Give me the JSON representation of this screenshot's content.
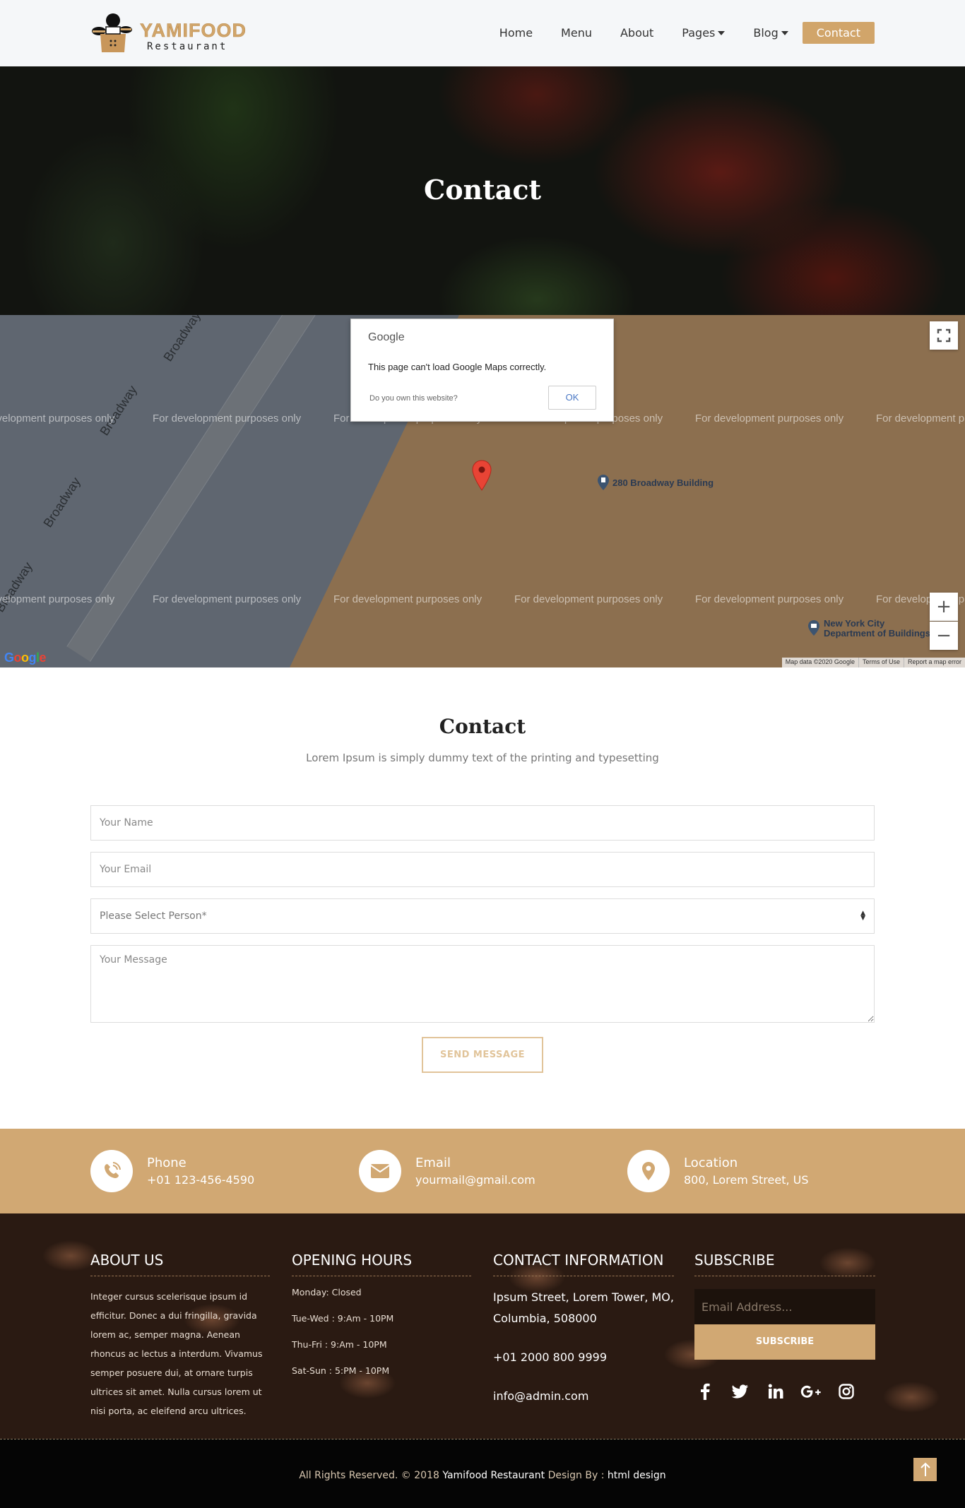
{
  "brand": {
    "name": "YAMIFOOD",
    "tagline": "Restaurant"
  },
  "nav": {
    "items": [
      {
        "label": "Home"
      },
      {
        "label": "Menu"
      },
      {
        "label": "About"
      },
      {
        "label": "Pages"
      },
      {
        "label": "Blog"
      }
    ],
    "cta_label": "Contact"
  },
  "hero": {
    "title": "Contact"
  },
  "map": {
    "dialog_brand": "Google",
    "dialog_message": "This page can't load Google Maps correctly.",
    "dialog_own": "Do you own this website?",
    "dialog_ok": "OK",
    "watermark": "For development purposes only",
    "road_label": "Broadway",
    "poi_1": "280 Broadway Building",
    "poi_2_line1": "New York City",
    "poi_2_line2": "Department of Buildings",
    "logo": "Google",
    "footer_data": "Map data ©2020 Google",
    "footer_terms": "Terms of Use",
    "footer_report": "Report a map error",
    "zoom_in": "+",
    "zoom_out": "−"
  },
  "contact": {
    "title": "Contact",
    "subtitle": "Lorem Ipsum is simply dummy text of the printing and typesetting",
    "name_placeholder": "Your Name",
    "email_placeholder": "Your Email",
    "person_select": "Please Select Person*",
    "message_placeholder": "Your Message",
    "send_label": "SEND MESSAGE"
  },
  "info": {
    "phone_label": "Phone",
    "phone_value": "+01 123-456-4590",
    "email_label": "Email",
    "email_value": "yourmail@gmail.com",
    "location_label": "Location",
    "location_value": "800, Lorem Street, US"
  },
  "footer": {
    "about_title": "ABOUT US",
    "about_text": "Integer cursus scelerisque ipsum id efficitur. Donec a dui fringilla, gravida lorem ac, semper magna. Aenean rhoncus ac lectus a interdum. Vivamus semper posuere dui, at ornare turpis ultrices sit amet. Nulla cursus lorem ut nisi porta, ac eleifend arcu ultrices.",
    "hours_title": "OPENING HOURS",
    "hours": [
      "Monday: Closed",
      "Tue-Wed : 9:Am - 10PM",
      "Thu-Fri : 9:Am - 10PM",
      "Sat-Sun : 5:PM - 10PM"
    ],
    "contact_title": "CONTACT INFORMATION",
    "contact_address": "Ipsum Street, Lorem Tower, MO, Columbia, 508000",
    "contact_phone": "+01 2000 800 9999",
    "contact_email": "info@admin.com",
    "subscribe_title": "SUBSCRIBE",
    "subscribe_placeholder": "Email Address...",
    "subscribe_button": "SUBSCRIBE",
    "social_icons": [
      "facebook-icon",
      "twitter-icon",
      "linkedin-icon",
      "google-plus-icon",
      "instagram-icon"
    ]
  },
  "bottom": {
    "prefix": "All Rights Reserved. © 2018",
    "brand": "Yamifood Restaurant",
    "design_by": "Design By :",
    "designer": "html design"
  },
  "colors": {
    "accent": "#d1a873",
    "nav_cta": "#d1a56a",
    "footer_bg": "#2a1a12"
  }
}
